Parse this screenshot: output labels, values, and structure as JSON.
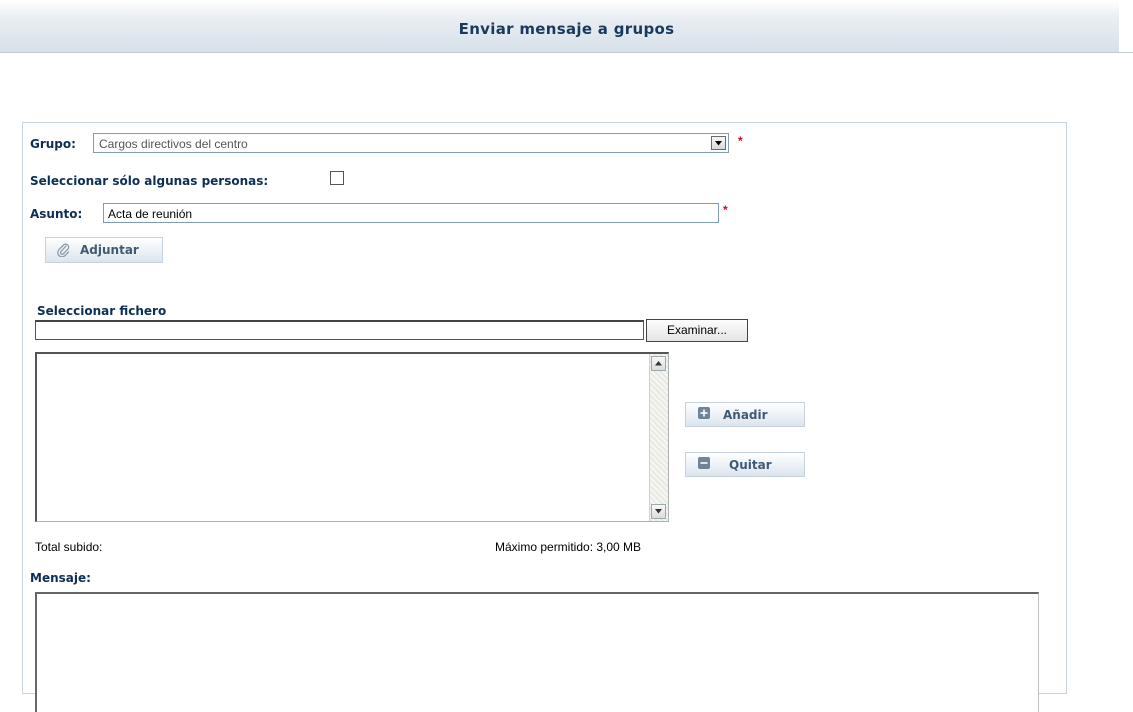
{
  "header": {
    "title": "Enviar mensaje a grupos"
  },
  "form": {
    "grupo_label": "Grupo:",
    "grupo_value": "Cargos directivos del centro",
    "required_mark": "*",
    "select_personas_label": "Seleccionar sólo algunas personas:",
    "select_personas_checked": false,
    "asunto_label": "Asunto:",
    "asunto_value": "Acta de reunión",
    "adjuntar_label": "Adjuntar"
  },
  "attachments": {
    "section_title": "Seleccionar fichero",
    "file_path_value": "",
    "browse_label": "Examinar...",
    "add_label": "Añadir",
    "remove_label": "Quitar",
    "total_label": "Total subido:",
    "max_label": "Máximo permitido: 3,00 MB"
  },
  "message": {
    "label": "Mensaje:",
    "value": ""
  },
  "icons": {
    "paperclip": "paperclip-icon",
    "add": "plus-square-icon",
    "remove": "minus-square-icon",
    "dropdown": "chevron-down-icon"
  },
  "colors": {
    "label_text": "#0d2f55",
    "required": "#e0001b",
    "button_text": "#415a74",
    "header_text": "#1a3a5c"
  }
}
